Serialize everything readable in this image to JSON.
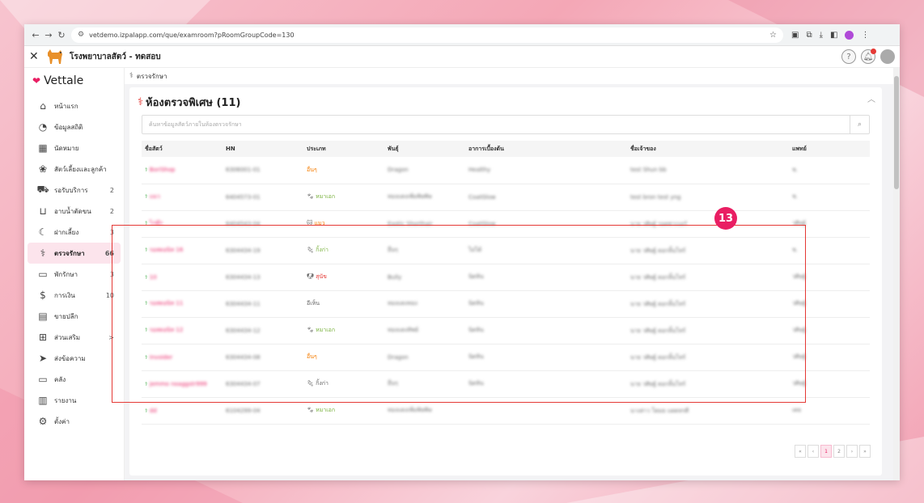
{
  "browser": {
    "url": "vetdemo.izpalapp.com/que/examroom?pRoomGroupCode=130",
    "back_icon": "arrow-left-icon",
    "forward_icon": "arrow-right-icon",
    "reload_icon": "reload-icon"
  },
  "app": {
    "title": "โรงพยาบาลสัตว์ - ทดสอบ",
    "brand": "Vettale"
  },
  "sidebar": {
    "items": [
      {
        "label": "หน้าแรก",
        "count": "",
        "icon": "home-icon"
      },
      {
        "label": "ข้อมูลสถิติ",
        "count": "",
        "icon": "stats-icon"
      },
      {
        "label": "นัดหมาย",
        "count": "",
        "icon": "calendar-icon"
      },
      {
        "label": "สัตว์เลี้ยงและลูกค้า",
        "count": "",
        "icon": "paw-icon"
      },
      {
        "label": "รอรับบริการ",
        "count": "2",
        "icon": "car-icon"
      },
      {
        "label": "อาบน้ำตัดขน",
        "count": "2",
        "icon": "bath-icon"
      },
      {
        "label": "ฝากเลี้ยง",
        "count": "3",
        "icon": "moon-icon"
      },
      {
        "label": "ตรวจรักษา",
        "count": "66",
        "icon": "stethoscope-icon"
      },
      {
        "label": "พักรักษา",
        "count": "3",
        "icon": "bed-icon"
      },
      {
        "label": "การเงิน",
        "count": "10",
        "icon": "money-icon"
      },
      {
        "label": "ขายปลีก",
        "count": "",
        "icon": "register-icon"
      },
      {
        "label": "ส่วนเสริม",
        "count": ">",
        "icon": "plus-icon"
      },
      {
        "label": "ส่งข้อความ",
        "count": "",
        "icon": "send-icon"
      },
      {
        "label": "คลัง",
        "count": "",
        "icon": "inventory-icon"
      },
      {
        "label": "รายงาน",
        "count": "",
        "icon": "report-icon"
      },
      {
        "label": "ตั้งค่า",
        "count": "",
        "icon": "settings-icon"
      }
    ]
  },
  "breadcrumb": "ตรวจรักษา",
  "card": {
    "title": "ห้องตรวจพิเศษ (11)",
    "search_placeholder": "ค้นหาข้อมูลสัตว์ภายในห้องตรวจรักษา"
  },
  "table": {
    "headers": [
      "ชื่อสัตว์",
      "HN",
      "ประเภท",
      "พันธุ์",
      "อาการเบื้องต้น",
      "ชื่อเจ้าของ",
      "แพทย์"
    ],
    "rows": [
      {
        "name": "BoriShop",
        "hn": "6306001-01",
        "type": "อื่นๆ",
        "type_color": "orange",
        "breed": "Dragon",
        "symptom": "Healthy",
        "owner": "test Shun bb",
        "doctor": "ช."
      },
      {
        "name": "แมว",
        "hn": "6404573-01",
        "type": "หมาเอก",
        "type_color": "green",
        "breed": "ทองแดงเพิ่มพิษพิษ",
        "symptom": "CoatGlow",
        "owner": "test bron test yng",
        "doctor": "ช."
      },
      {
        "name": "ไก่ตุ๊ก",
        "hn": "6404543-04",
        "type": "แมว",
        "type_color": "orange",
        "breed": "Exotic Shorthair",
        "symptom": "CoatGlow",
        "owner": "นาย วศิษฐ์ รอดซาเบอร์",
        "doctor": "วศิษฐ์"
      },
      {
        "name": "รอสดอนิท 16",
        "hn": "6304434-19",
        "type": "กิ้งก่า",
        "type_color": "green",
        "breed": "อื่นๆ",
        "symptom": "ไม่ได้",
        "owner": "นาย วศิษฐ์ ดอกลิ้นโทร์",
        "doctor": "ช."
      },
      {
        "name": "10",
        "hn": "6304434-13",
        "type": "สุนัข",
        "type_color": "red",
        "breed": "Bully",
        "symptom": "นิดหิน",
        "owner": "นาย วศิษฐ์ ดอกลิ้นโทร์",
        "doctor": "วศิษฐ์"
      },
      {
        "name": "รอสดอนิท 11",
        "hn": "6304434-11",
        "type": "อีเห็น",
        "type_color": "",
        "breed": "ทองแดงทอง",
        "symptom": "นิดหิน",
        "owner": "นาย วศิษฐ์ ดอกลิ้นโทร์",
        "doctor": "วศิษฐ์"
      },
      {
        "name": "รอสดอนิท 12",
        "hn": "6304434-12",
        "type": "หมาเอก",
        "type_color": "green",
        "breed": "ทองแดงทิพย์",
        "symptom": "นิดหิน",
        "owner": "นาย วศิษฐ์ ดอกลิ้นโทร์",
        "doctor": "วศิษฐ์"
      },
      {
        "name": "Invoider",
        "hn": "6304434-08",
        "type": "อื่นๆ",
        "type_color": "orange",
        "breed": "Dragon",
        "symptom": "นิดหิน",
        "owner": "นาย วศิษฐ์ ดอกลิ้นโทร์",
        "doctor": "วศิษฐ์"
      },
      {
        "name": "jemmo noaggstr999",
        "hn": "6304434-07",
        "type": "กิ้งก่า",
        "type_color": "",
        "breed": "อื่นๆ",
        "symptom": "นิดหิน",
        "owner": "นาย วศิษฐ์ ดอกลิ้นโทร์",
        "doctor": "วศิษฐ์"
      },
      {
        "name": "dd",
        "hn": "6104299-04",
        "type": "หมาเอก",
        "type_color": "green",
        "breed": "ทองแดงเพิ่มพิษพิษ",
        "symptom": "",
        "owner": "นางสาว โดมย แดดหรดี",
        "doctor": "เดย"
      }
    ]
  },
  "callout": "13",
  "pager": [
    "«",
    "‹",
    "1",
    "2",
    "›",
    "»"
  ]
}
